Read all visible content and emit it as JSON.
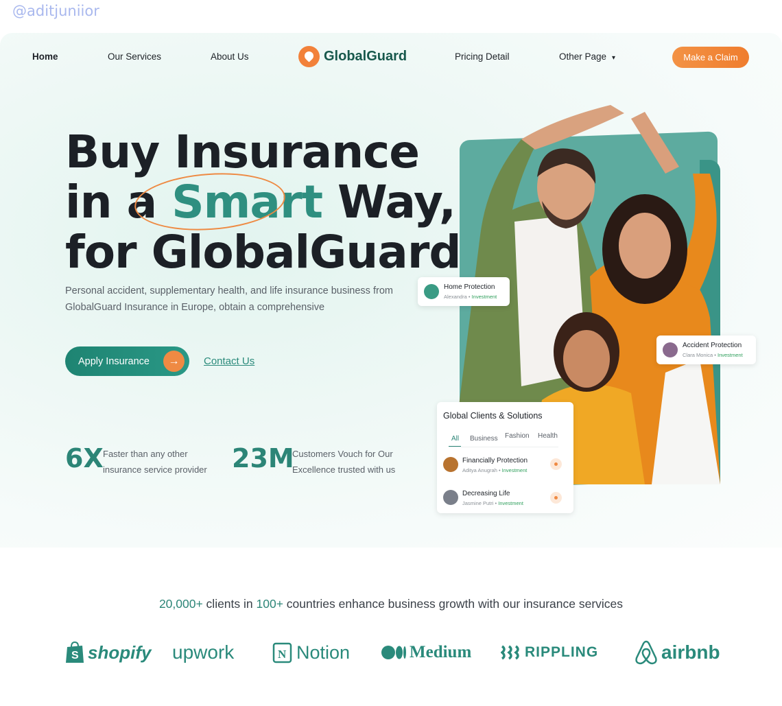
{
  "watermark": "@aditjuniior",
  "nav": {
    "home": "Home",
    "services": "Our Services",
    "about": "About Us",
    "logo": "GlobalGuard",
    "pricing": "Pricing Detail",
    "other": "Other Page",
    "claim": "Make a Claim"
  },
  "hero": {
    "line1": "Buy Insurance",
    "line2_a": "in a ",
    "line2_smart": "Smart",
    "line2_b": " Way,",
    "line3": "for GlobalGuard",
    "description": "Personal accident, supplementary health, and life insurance business from GlobalGuard Insurance in Europe, obtain a comprehensive",
    "apply": "Apply Insurance",
    "contact": "Contact Us"
  },
  "stats": [
    {
      "value": "6X",
      "text": "Faster than any other insurance service provider"
    },
    {
      "value": "23M",
      "text": "Customers Vouch for Our Excellence trusted with us"
    }
  ],
  "cards": {
    "home": {
      "title": "Home Protection",
      "sub": "Alexandra",
      "tag": "Investment"
    },
    "accident": {
      "title": "Accident Protection",
      "sub": "Clara Monica",
      "tag": "Investment"
    },
    "global": {
      "title": "Global Clients & Solutions",
      "tabs": [
        "All",
        "Business",
        "Fashion",
        "Health"
      ],
      "items": [
        {
          "title": "Financially Protection",
          "sub": "Aditya Anugrah",
          "tag": "Investment"
        },
        {
          "title": "Decreasing Life",
          "sub": "Jasmine Putri",
          "tag": "Investment"
        }
      ]
    }
  },
  "clients": {
    "count": "20,000+",
    "mid": " clients in ",
    "countries": "100+",
    "rest": " countries enhance business growth with our insurance services"
  },
  "brands": [
    "shopify",
    "upwork",
    "Notion",
    "Medium",
    "RIPPLING",
    "airbnb"
  ],
  "colors": {
    "brand_green": "#2c8577",
    "accent_orange": "#ef8a43"
  }
}
